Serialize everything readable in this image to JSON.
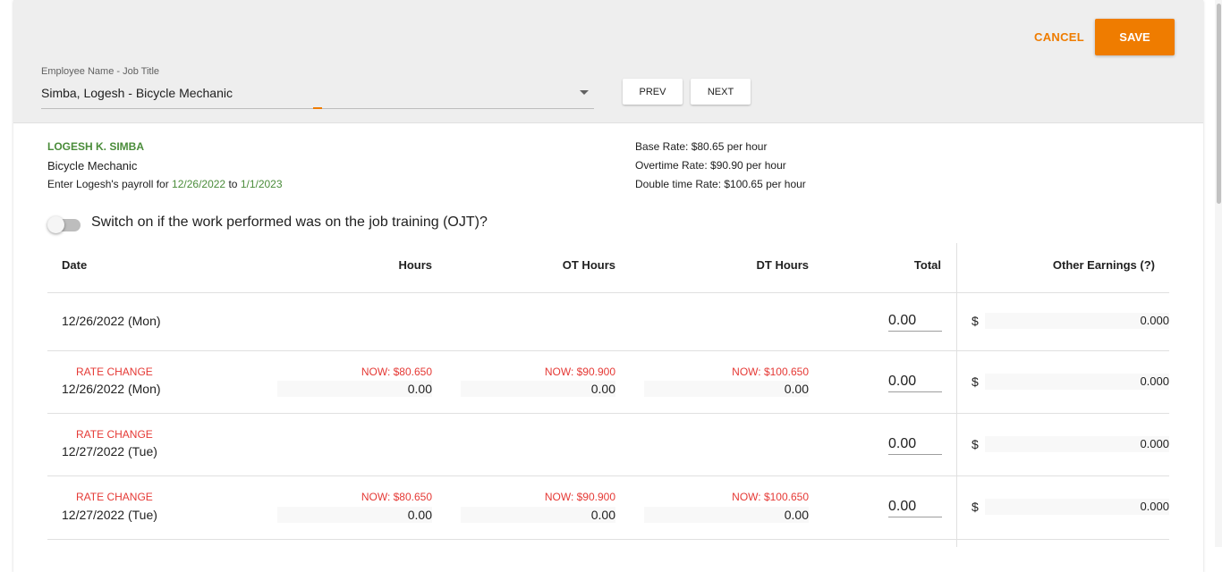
{
  "toolbar": {
    "cancel_label": "CANCEL",
    "save_label": "SAVE"
  },
  "employee_select": {
    "label": "Employee Name - Job Title",
    "value": "Simba, Logesh - Bicycle Mechanic",
    "prev_label": "PREV",
    "next_label": "NEXT"
  },
  "employee": {
    "name": "LOGESH K. SIMBA",
    "title": "Bicycle Mechanic",
    "period_prefix": "Enter Logesh's payroll for",
    "period_start": "12/26/2022",
    "period_to": "to",
    "period_end": "1/1/2023"
  },
  "rates": {
    "base": "Base Rate: $80.65 per hour",
    "overtime": "Overtime Rate: $90.90 per hour",
    "double": "Double time Rate: $100.65 per hour"
  },
  "ojt_toggle": {
    "label": "Switch on if the work performed was on the job training (OJT)?",
    "on": false
  },
  "table": {
    "headers": {
      "date": "Date",
      "hours": "Hours",
      "ot_hours": "OT Hours",
      "dt_hours": "DT Hours",
      "total": "Total",
      "other": "Other Earnings (?)"
    },
    "rows": [
      {
        "rate_change": "",
        "date": "12/26/2022 (Mon)",
        "hours_now": "",
        "hours": "",
        "ot_now": "",
        "ot": "",
        "dt_now": "",
        "dt": "",
        "total": "0.00",
        "currency": "$",
        "other": "0.000"
      },
      {
        "rate_change": "RATE CHANGE",
        "date": "12/26/2022 (Mon)",
        "hours_now": "NOW: $80.650",
        "hours": "0.00",
        "ot_now": "NOW: $90.900",
        "ot": "0.00",
        "dt_now": "NOW: $100.650",
        "dt": "0.00",
        "total": "0.00",
        "currency": "$",
        "other": "0.000"
      },
      {
        "rate_change": "RATE CHANGE",
        "date": "12/27/2022 (Tue)",
        "hours_now": "",
        "hours": "",
        "ot_now": "",
        "ot": "",
        "dt_now": "",
        "dt": "",
        "total": "0.00",
        "currency": "$",
        "other": "0.000"
      },
      {
        "rate_change": "RATE CHANGE",
        "date": "12/27/2022 (Tue)",
        "hours_now": "NOW: $80.650",
        "hours": "0.00",
        "ot_now": "NOW: $90.900",
        "ot": "0.00",
        "dt_now": "NOW: $100.650",
        "dt": "0.00",
        "total": "0.00",
        "currency": "$",
        "other": "0.000"
      }
    ]
  },
  "colors": {
    "accent": "#ef7c00",
    "green": "#4a8c3a",
    "alert": "#e53935"
  }
}
